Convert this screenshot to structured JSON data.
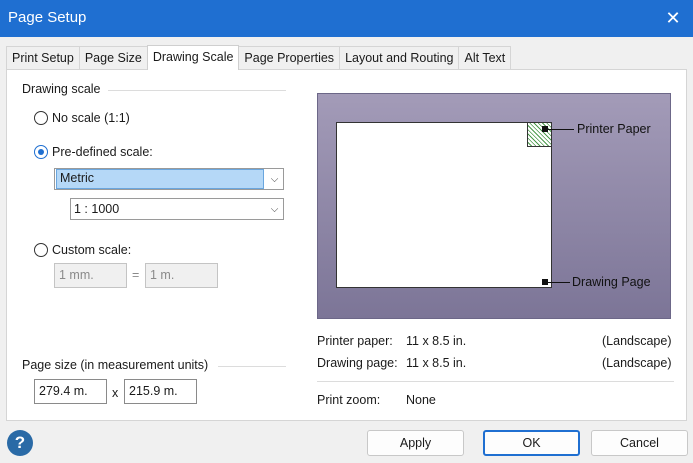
{
  "window": {
    "title": "Page Setup",
    "close_glyph": "✕"
  },
  "tabs": [
    {
      "label": "Print Setup"
    },
    {
      "label": "Page Size"
    },
    {
      "label": "Drawing Scale",
      "active": true
    },
    {
      "label": "Page Properties"
    },
    {
      "label": "Layout and Routing"
    },
    {
      "label": "Alt Text"
    }
  ],
  "drawing_scale": {
    "group_label": "Drawing scale",
    "no_scale_label": "No scale (1:1)",
    "predefined_label": "Pre-defined scale:",
    "predefined_checked": true,
    "category_value": "Metric",
    "ratio_value": "1 : 1000",
    "custom_label": "Custom scale:",
    "custom_left": "1 mm.",
    "custom_equals": "=",
    "custom_right": "1 m."
  },
  "page_size": {
    "group_label": "Page size (in measurement units)",
    "width": "279.4 m.",
    "times": "x",
    "height": "215.9 m."
  },
  "preview": {
    "printer_paper_callout": "Printer Paper",
    "drawing_page_callout": "Drawing Page"
  },
  "info": {
    "printer_paper_label": "Printer paper:",
    "printer_paper_size": "11 x 8.5 in.",
    "printer_paper_orientation": "(Landscape)",
    "drawing_page_label": "Drawing page:",
    "drawing_page_size": "11 x 8.5 in.",
    "drawing_page_orientation": "(Landscape)",
    "print_zoom_label": "Print zoom:",
    "print_zoom_value": "None"
  },
  "buttons": {
    "apply": "Apply",
    "ok": "OK",
    "cancel": "Cancel",
    "help": "?"
  },
  "colors": {
    "accent": "#1f6fd1",
    "selection": "#b5d8f7"
  }
}
